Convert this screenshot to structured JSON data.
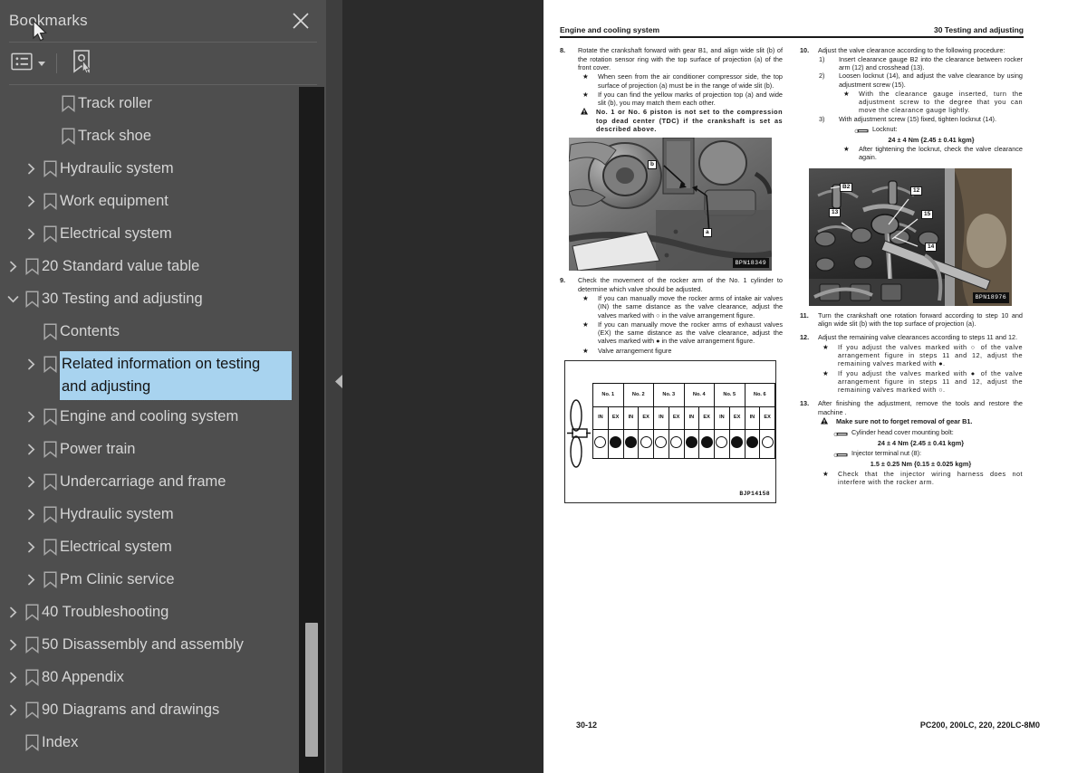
{
  "panel": {
    "title": "Bookmarks",
    "close_icon": "close-icon",
    "toolbar": {
      "options_icon": "list-options-icon",
      "options_caret": "chevron-down-icon",
      "find_bookmark_icon": "bookmark-pointer-icon"
    }
  },
  "tree": [
    {
      "label": "Track roller",
      "indent": 2,
      "twisty": "none",
      "selected": false
    },
    {
      "label": "Track shoe",
      "indent": 2,
      "twisty": "none",
      "selected": false
    },
    {
      "label": "Hydraulic system",
      "indent": 1,
      "twisty": "collapsed",
      "selected": false
    },
    {
      "label": "Work equipment",
      "indent": 1,
      "twisty": "collapsed",
      "selected": false
    },
    {
      "label": "Electrical system",
      "indent": 1,
      "twisty": "collapsed",
      "selected": false
    },
    {
      "label": "20 Standard value table",
      "indent": 0,
      "twisty": "collapsed",
      "selected": false
    },
    {
      "label": "30 Testing and adjusting",
      "indent": 0,
      "twisty": "expanded",
      "selected": false
    },
    {
      "label": "Contents",
      "indent": 1,
      "twisty": "none",
      "selected": false
    },
    {
      "label": "Related information on testing and adjusting",
      "indent": 1,
      "twisty": "collapsed",
      "selected": true
    },
    {
      "label": "Engine and cooling system",
      "indent": 1,
      "twisty": "collapsed",
      "selected": false
    },
    {
      "label": "Power train",
      "indent": 1,
      "twisty": "collapsed",
      "selected": false
    },
    {
      "label": "Undercarriage and frame",
      "indent": 1,
      "twisty": "collapsed",
      "selected": false
    },
    {
      "label": "Hydraulic system",
      "indent": 1,
      "twisty": "collapsed",
      "selected": false
    },
    {
      "label": "Electrical system",
      "indent": 1,
      "twisty": "collapsed",
      "selected": false
    },
    {
      "label": "Pm Clinic service",
      "indent": 1,
      "twisty": "collapsed",
      "selected": false
    },
    {
      "label": "40 Troubleshooting",
      "indent": 0,
      "twisty": "collapsed",
      "selected": false
    },
    {
      "label": "50 Disassembly and assembly",
      "indent": 0,
      "twisty": "collapsed",
      "selected": false
    },
    {
      "label": "80 Appendix",
      "indent": 0,
      "twisty": "collapsed",
      "selected": false
    },
    {
      "label": "90 Diagrams and drawings",
      "indent": 0,
      "twisty": "collapsed",
      "selected": false
    },
    {
      "label": "Index",
      "indent": 0,
      "twisty": "none",
      "selected": false
    }
  ],
  "splitter": {
    "collapse_icon": "chevron-left-icon"
  },
  "document": {
    "header_left": "Engine and cooling system",
    "header_right": "30 Testing and adjusting",
    "footer_left": "30-12",
    "footer_right": "PC200, 200LC, 220, 220LC-8M0",
    "left_column": {
      "step8": {
        "num": "8.",
        "body": "Rotate the crankshaft forward with gear B1, and align wide slit (b) of the rotation sensor ring with the top surface of projection (a) of the front cover.",
        "bullets": [
          {
            "mark": "★",
            "text": "When seen from the air conditioner compressor side, the top surface of projection (a) must be in the range of wide slit (b).",
            "bold": false
          },
          {
            "mark": "★",
            "text": "If you can find the yellow marks of projection top (a) and wide slit (b), you may match them  each other.",
            "bold": false
          },
          {
            "mark": "warn",
            "text": "No. 1 or No. 6 piston is not set to the compression top dead center (TDC) if the crankshaft is set as described above.",
            "bold": true
          }
        ]
      },
      "photo1_code": "BPN18349",
      "photo1_callouts": [
        "b",
        "a"
      ],
      "step9": {
        "num": "9.",
        "body": "Check the movement of the rocker arm of the No. 1 cylinder to determine which valve should be adjusted.",
        "bullets": [
          {
            "mark": "★",
            "text": "If you can manually move the rocker arms of intake air valves (IN) the same distance as the valve clearance, adjust the valves marked with ○ in the valve arrangement figure."
          },
          {
            "mark": "★",
            "text": "If you can manually move the rocker arms of exhaust valves (EX) the same distance as the valve clearance, adjust the valves marked with ● in the valve arrangement figure."
          },
          {
            "mark": "★",
            "text": "Valve arrangement figure"
          }
        ]
      },
      "valve_figure": {
        "code": "BJP14158",
        "cylinders": [
          {
            "name": "No. 1",
            "in_label": "IN",
            "ex_label": "EX",
            "in_state": "open",
            "ex_state": "filled"
          },
          {
            "name": "No. 2",
            "in_label": "IN",
            "ex_label": "EX",
            "in_state": "filled",
            "ex_state": "open"
          },
          {
            "name": "No. 3",
            "in_label": "IN",
            "ex_label": "EX",
            "in_state": "open",
            "ex_state": "open"
          },
          {
            "name": "No. 4",
            "in_label": "IN",
            "ex_label": "EX",
            "in_state": "filled",
            "ex_state": "filled"
          },
          {
            "name": "No. 5",
            "in_label": "IN",
            "ex_label": "EX",
            "in_state": "open",
            "ex_state": "filled"
          },
          {
            "name": "No. 6",
            "in_label": "IN",
            "ex_label": "EX",
            "in_state": "filled",
            "ex_state": "open"
          }
        ]
      }
    },
    "right_column": {
      "step10": {
        "num": "10.",
        "body": "Adjust the valve clearance according to the following procedure:",
        "subs": [
          {
            "num": "1)",
            "text": "Insert clearance gauge B2 into the clearance between rocker arm (12) and crosshead (13)."
          },
          {
            "num": "2)",
            "text": "Loosen locknut (14), and adjust the valve clearance by using adjustment screw (15).",
            "bullets": [
              {
                "mark": "★",
                "text": "With the clearance gauge inserted, turn the adjustment screw to the degree that you can move the clearance gauge lightly."
              }
            ]
          },
          {
            "num": "3)",
            "text": "With adjustment screw (15) fixed, tighten locknut (14).",
            "tool": {
              "label": "Locknut:",
              "torque": "24 ± 4 Nm {2.45 ± 0.41 kgm}"
            },
            "bullets": [
              {
                "mark": "★",
                "text": "After tightening the locknut, check the valve clearance again."
              }
            ]
          }
        ]
      },
      "photo2_code": "BPN18976",
      "photo2_callouts": [
        "B2",
        "12",
        "13",
        "15",
        "14"
      ],
      "step11": {
        "num": "11.",
        "body": "Turn the crankshaft   one rotation forward according to step 10 and align wide slit (b) with the top surface of projection (a)."
      },
      "step12": {
        "num": "12.",
        "body": "Adjust the remaining valve clearances according to steps 11 and 12.",
        "bullets": [
          {
            "mark": "★",
            "text": "If you adjust the valves marked with ○ of the valve arrangement figure in steps 11 and 12, adjust the remaining valves marked with ●."
          },
          {
            "mark": "★",
            "text": "If you adjust the valves marked with ● of the valve arrangement figure in steps 11 and 12, adjust the remaining valves marked with ○."
          }
        ]
      },
      "step13": {
        "num": "13.",
        "body": "After finishing the adjustment, remove the tools and restore the machine .",
        "warn": {
          "mark": "warn",
          "text": "Make sure not to forget removal of gear B1."
        },
        "tools": [
          {
            "label": "Cylinder head cover mounting bolt:",
            "torque": "24 ± 4 Nm {2.45 ± 0.41 kgm}"
          },
          {
            "label": "Injector terminal nut (8):",
            "torque": "1.5 ± 0.25 Nm {0.15 ± 0.025 kgm}"
          }
        ],
        "bullets": [
          {
            "mark": "★",
            "text": "Check that the injector wiring harness does not interfere with the rocker arm."
          }
        ]
      }
    }
  },
  "colors": {
    "panel_bg": "#4e4e4e",
    "viewer_bg": "#2b2b2b",
    "splitter_bg": "#3e3e3e",
    "selection": "#a8d3ef",
    "text": "#d6d6d6",
    "scroll_track": "#1b1b1b",
    "scroll_thumb": "#a8a8a8"
  }
}
